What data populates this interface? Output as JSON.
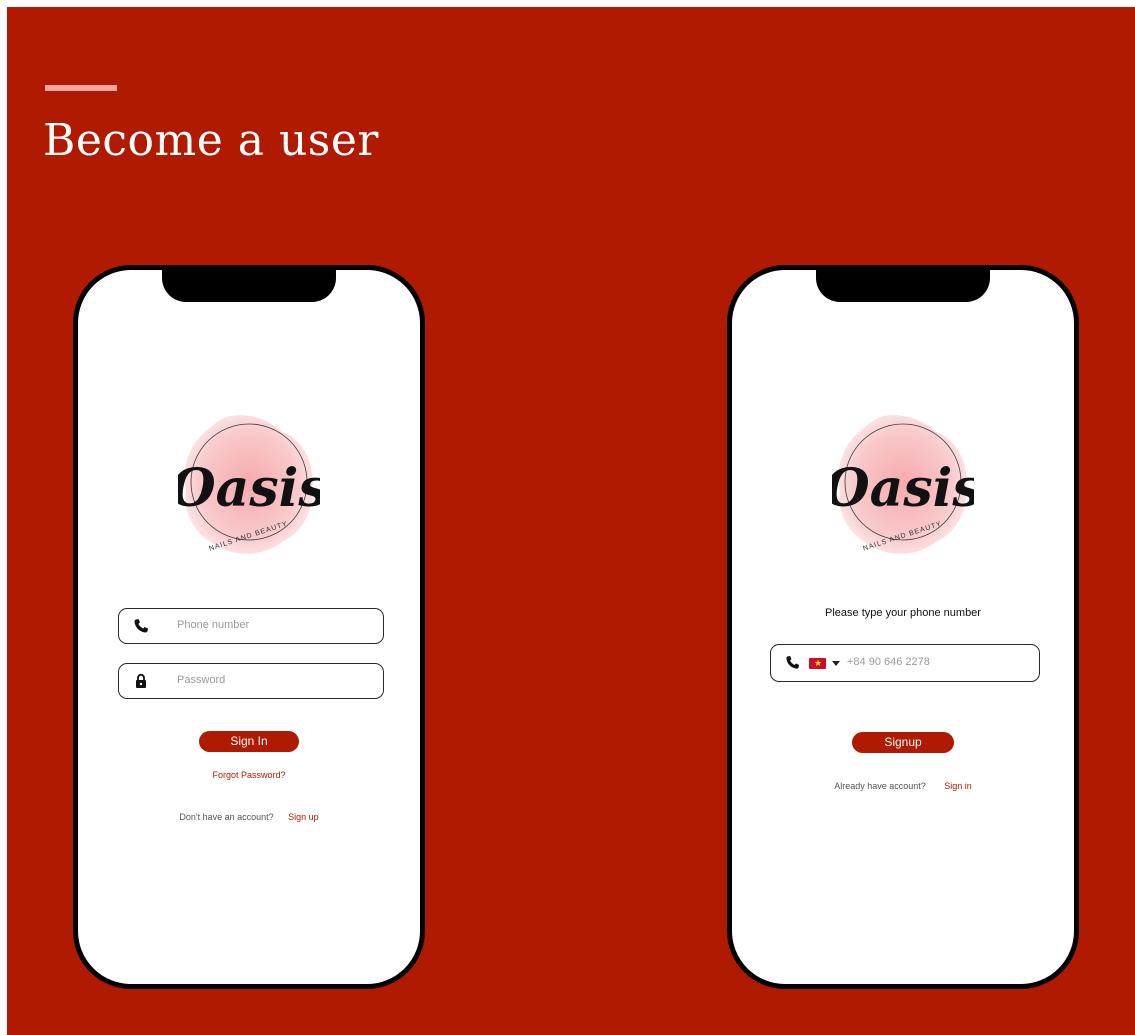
{
  "slide": {
    "heading": "Become a user",
    "colors": {
      "background": "#b01a00",
      "accent_line": "#f4a7a0",
      "button": "#b01a00"
    }
  },
  "logo": {
    "wordmark": "Oasis",
    "tagline": "NAILS AND BEAUTY"
  },
  "signin_screen": {
    "phone_field": {
      "icon": "phone-icon",
      "placeholder": "Phone number"
    },
    "password_field": {
      "icon": "lock-icon",
      "placeholder": "Password"
    },
    "signin_button": "Sign In",
    "forgot_password": "Forgot Password?",
    "no_account_text": "Don't have an account?",
    "signup_link": "Sign up"
  },
  "signup_screen": {
    "prompt": "Please type your phone number",
    "phone_field": {
      "icon": "phone-icon",
      "country_flag": "vietnam-flag-icon",
      "placeholder": "+84 90 646 2278"
    },
    "signup_button": "Signup",
    "have_account_text": "Already have account?",
    "signin_link": "Sign in"
  }
}
